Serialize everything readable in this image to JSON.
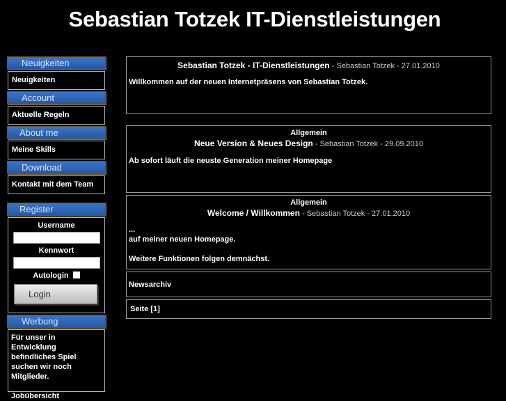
{
  "site_title": "Sebastian Totzek IT-Dienstleistungen",
  "sidebar": {
    "sections": [
      {
        "title": "Neuigkeiten",
        "link": "Neuigkeiten"
      },
      {
        "title": "Account",
        "link": "Aktuelle Regeln"
      },
      {
        "title": "About me",
        "link": "Meine Skills"
      },
      {
        "title": "Download",
        "link": "Kontakt mit dem Team"
      }
    ],
    "register": {
      "title": "Register",
      "username_label": "Username",
      "password_label": "Kennwort",
      "autologin_label": "Autologin",
      "login_button": "Login"
    },
    "ads": {
      "title": "Werbung",
      "text": "Für unser in Entwicklung befindliches Spiel suchen wir noch Mitglieder.",
      "link": "Jobübersicht"
    }
  },
  "news": [
    {
      "category": "",
      "title": "Sebastian Totzek - IT-Dienstleistungen",
      "meta": "- Sebastian Totzek - 27.01.2010",
      "body": [
        "Willkommen auf der neuen Internetpräsens von Sebastian Totzek."
      ]
    },
    {
      "category": "Allgemein",
      "title": "Neue Version & Neues Design",
      "meta": "- Sebastian Totzek - 29.09.2010",
      "body": [
        "Ab sofort läuft die neuste Generation meiner Homepage"
      ]
    },
    {
      "category": "Allgemein",
      "title": "Welcome / Willkommen",
      "meta": "- Sebastian Totzek - 27.01.2010",
      "body": [
        "...",
        "auf meiner neuen Homepage.",
        "Weitere Funktionen folgen demnächst."
      ]
    }
  ],
  "archive_link": "Newsarchiv",
  "pagination": "Seite [1]"
}
